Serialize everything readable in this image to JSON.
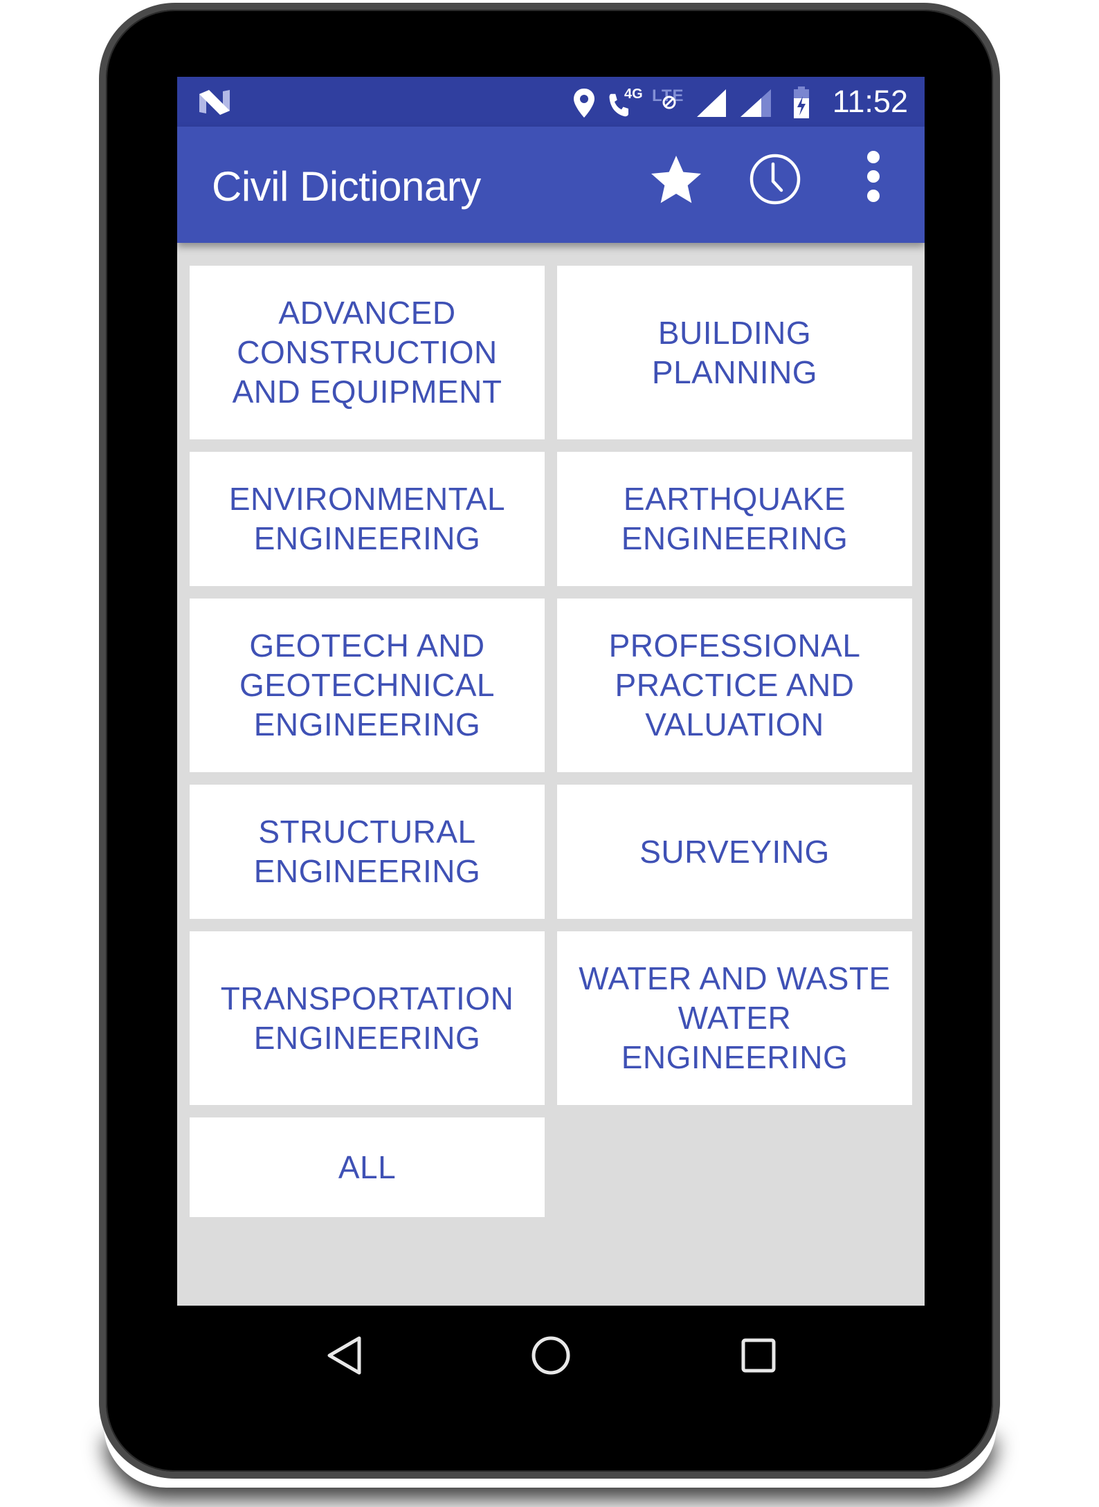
{
  "status_bar": {
    "logo_icon": "android-n-logo",
    "icons": [
      "location-pin-icon",
      "wifi-calling-4g-icon",
      "lte-disabled-icon",
      "signal-full-icon",
      "signal-partial-icon",
      "battery-charging-icon"
    ],
    "call_label": "4G",
    "lte_label": "LTE",
    "time": "11:52"
  },
  "app_bar": {
    "title": "Civil Dictionary",
    "actions": [
      {
        "name": "favorites",
        "icon": "star-icon"
      },
      {
        "name": "history",
        "icon": "clock-icon"
      },
      {
        "name": "more-options",
        "icon": "overflow-menu-icon"
      }
    ]
  },
  "categories": [
    {
      "label": "ADVANCED\nCONSTRUCTION\nAND EQUIPMENT"
    },
    {
      "label": "BUILDING\nPLANNING"
    },
    {
      "label": "ENVIRONMENTAL\nENGINEERING"
    },
    {
      "label": "EARTHQUAKE\nENGINEERING"
    },
    {
      "label": "GEOTECH AND\nGEOTECHNICAL\nENGINEERING"
    },
    {
      "label": "PROFESSIONAL\nPRACTICE AND\nVALUATION"
    },
    {
      "label": "STRUCTURAL\nENGINEERING"
    },
    {
      "label": "SURVEYING"
    },
    {
      "label": "TRANSPORTATION\nENGINEERING"
    },
    {
      "label": "WATER AND WASTE\nWATER\nENGINEERING"
    },
    {
      "label": "ALL"
    }
  ],
  "nav_bar": {
    "buttons": [
      "back",
      "home",
      "recents"
    ]
  },
  "colors": {
    "primary": "#3f51b5",
    "primary_dark": "#303f9f",
    "background": "#dcdcdc",
    "tile": "#ffffff"
  }
}
